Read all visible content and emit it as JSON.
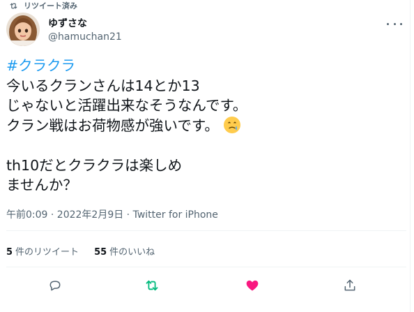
{
  "retweet_context": {
    "label": "リツイート済み"
  },
  "author": {
    "display_name": "ゆずさな",
    "handle": "@hamuchan21"
  },
  "tweet": {
    "hashtag": "#クラクラ",
    "text": "\n今いるクランさんは14とか13\nじゃないと活躍出来なそうなんです。\nクラン戦はお荷物感が強いです。",
    "emoji": "face-holding-back-tears-emoji",
    "text2": "\n\nth10だとクラクラは楽しめ\nませんか？"
  },
  "meta": {
    "timestamp": "午前0:09 · 2022年2月9日 · Twitter for iPhone"
  },
  "stats": {
    "retweets_count": "5",
    "retweets_label": "件のリツイート",
    "likes_count": "55",
    "likes_label": "件のいいね"
  },
  "actions": {
    "reply_icon": "reply-icon",
    "retweet_icon": "retweet-icon",
    "like_icon": "heart-icon",
    "share_icon": "share-icon"
  },
  "colors": {
    "accent": "#1d9bf0",
    "retweet_active": "#00ba7c",
    "like_active": "#f91880",
    "secondary_text": "#536471"
  }
}
